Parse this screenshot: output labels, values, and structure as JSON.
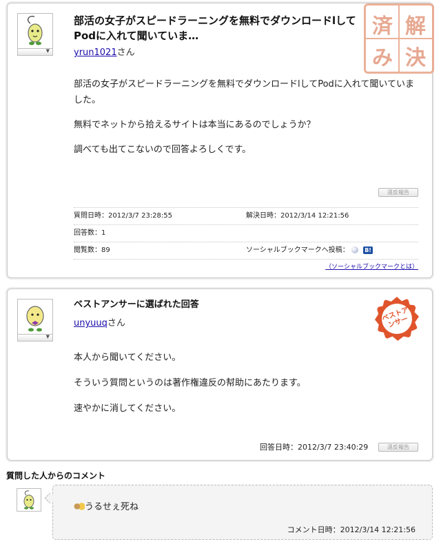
{
  "question": {
    "title": "部活の女子がスピードラーニングを無料でダウンロードlしてPodに入れて聞いていま…",
    "author_name": "yrun1021",
    "author_suffix": "さん",
    "body": [
      "部活の女子がスピードラーニングを無料でダウンロードlしてPodに入れて聞いていました。",
      "無料でネットから拾えるサイトは本当にあるのでしょうか？",
      "調べても出てこないので回答よろしくです。"
    ],
    "report_label": "違反報告",
    "stamp_text": "解決済み",
    "meta": {
      "asked": "質問日時：2012/3/7 23:28:55",
      "resolved": "解決日時：2012/3/14 12:21:56",
      "answers": "回答数：1",
      "views": "閲覧数：89",
      "social_label": "ソーシャルブックマークへ投稿：",
      "social_b_icon": "B!",
      "social_link": "（ソーシャルブックマークとは）"
    }
  },
  "answer": {
    "heading": "ベストアンサーに選ばれた回答",
    "author_name": "unyuuq",
    "author_suffix": "さん",
    "seal_text": "ベストアンサー",
    "body": [
      "本人から聞いてください。",
      "そういう質問というのは著作権違反の幇助にあたります。",
      "速やかに消してください。"
    ],
    "answered": "回答日時：2012/3/7 23:40:29",
    "report_label": "違反報告"
  },
  "comment": {
    "section_title": "質問した人からのコメント",
    "text": "うるせぇ死ね",
    "time": "コメント日時：2012/3/14 12:21:56"
  },
  "colors": {
    "link": "#1a0dab",
    "stamp": "#e39a7e",
    "seal": "#e0542c"
  }
}
